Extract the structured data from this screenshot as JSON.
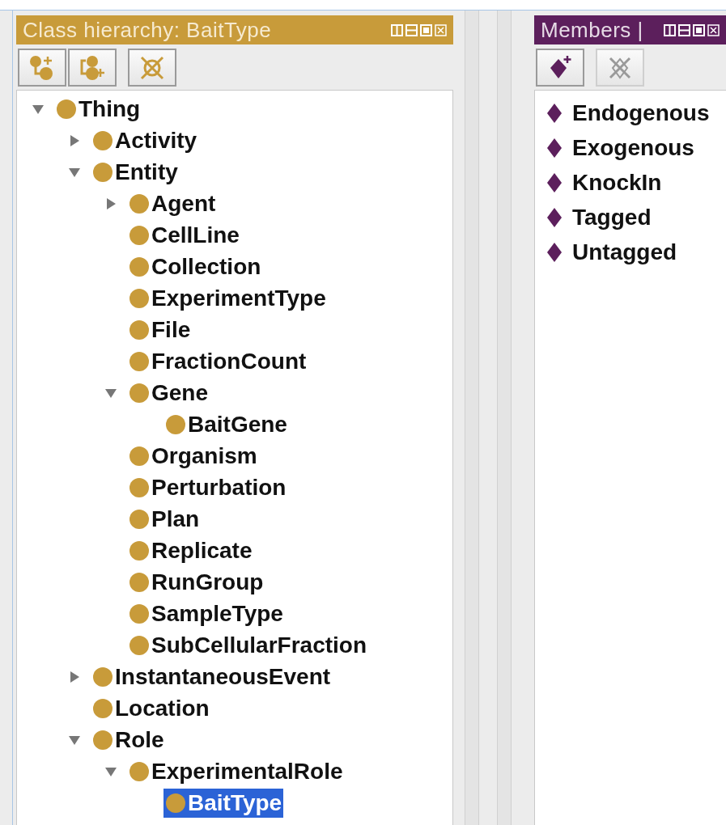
{
  "class_panel": {
    "title": "Class hierarchy: BaitType",
    "tree": [
      {
        "label": "Thing",
        "expanded": true,
        "selected": false,
        "children": [
          {
            "label": "Activity",
            "expanded": false,
            "selected": false
          },
          {
            "label": "Entity",
            "expanded": true,
            "selected": false,
            "children": [
              {
                "label": "Agent",
                "expanded": false,
                "selected": false
              },
              {
                "label": "CellLine",
                "selected": false
              },
              {
                "label": "Collection",
                "selected": false
              },
              {
                "label": "ExperimentType",
                "selected": false
              },
              {
                "label": "File",
                "selected": false
              },
              {
                "label": "FractionCount",
                "selected": false
              },
              {
                "label": "Gene",
                "expanded": true,
                "selected": false,
                "children": [
                  {
                    "label": "BaitGene",
                    "selected": false
                  }
                ]
              },
              {
                "label": "Organism",
                "selected": false
              },
              {
                "label": "Perturbation",
                "selected": false
              },
              {
                "label": "Plan",
                "selected": false
              },
              {
                "label": "Replicate",
                "selected": false
              },
              {
                "label": "RunGroup",
                "selected": false
              },
              {
                "label": "SampleType",
                "selected": false
              },
              {
                "label": "SubCellularFraction",
                "selected": false
              }
            ]
          },
          {
            "label": "InstantaneousEvent",
            "expanded": false,
            "selected": false
          },
          {
            "label": "Location",
            "selected": false
          },
          {
            "label": "Role",
            "expanded": true,
            "selected": false,
            "children": [
              {
                "label": "ExperimentalRole",
                "expanded": true,
                "selected": false,
                "children": [
                  {
                    "label": "BaitType",
                    "selected": true
                  }
                ]
              }
            ]
          }
        ]
      }
    ]
  },
  "members_panel": {
    "title": "Members |",
    "members": [
      {
        "label": "Endogenous"
      },
      {
        "label": "Exogenous"
      },
      {
        "label": "KnockIn"
      },
      {
        "label": "Tagged"
      },
      {
        "label": "Untagged"
      }
    ]
  }
}
